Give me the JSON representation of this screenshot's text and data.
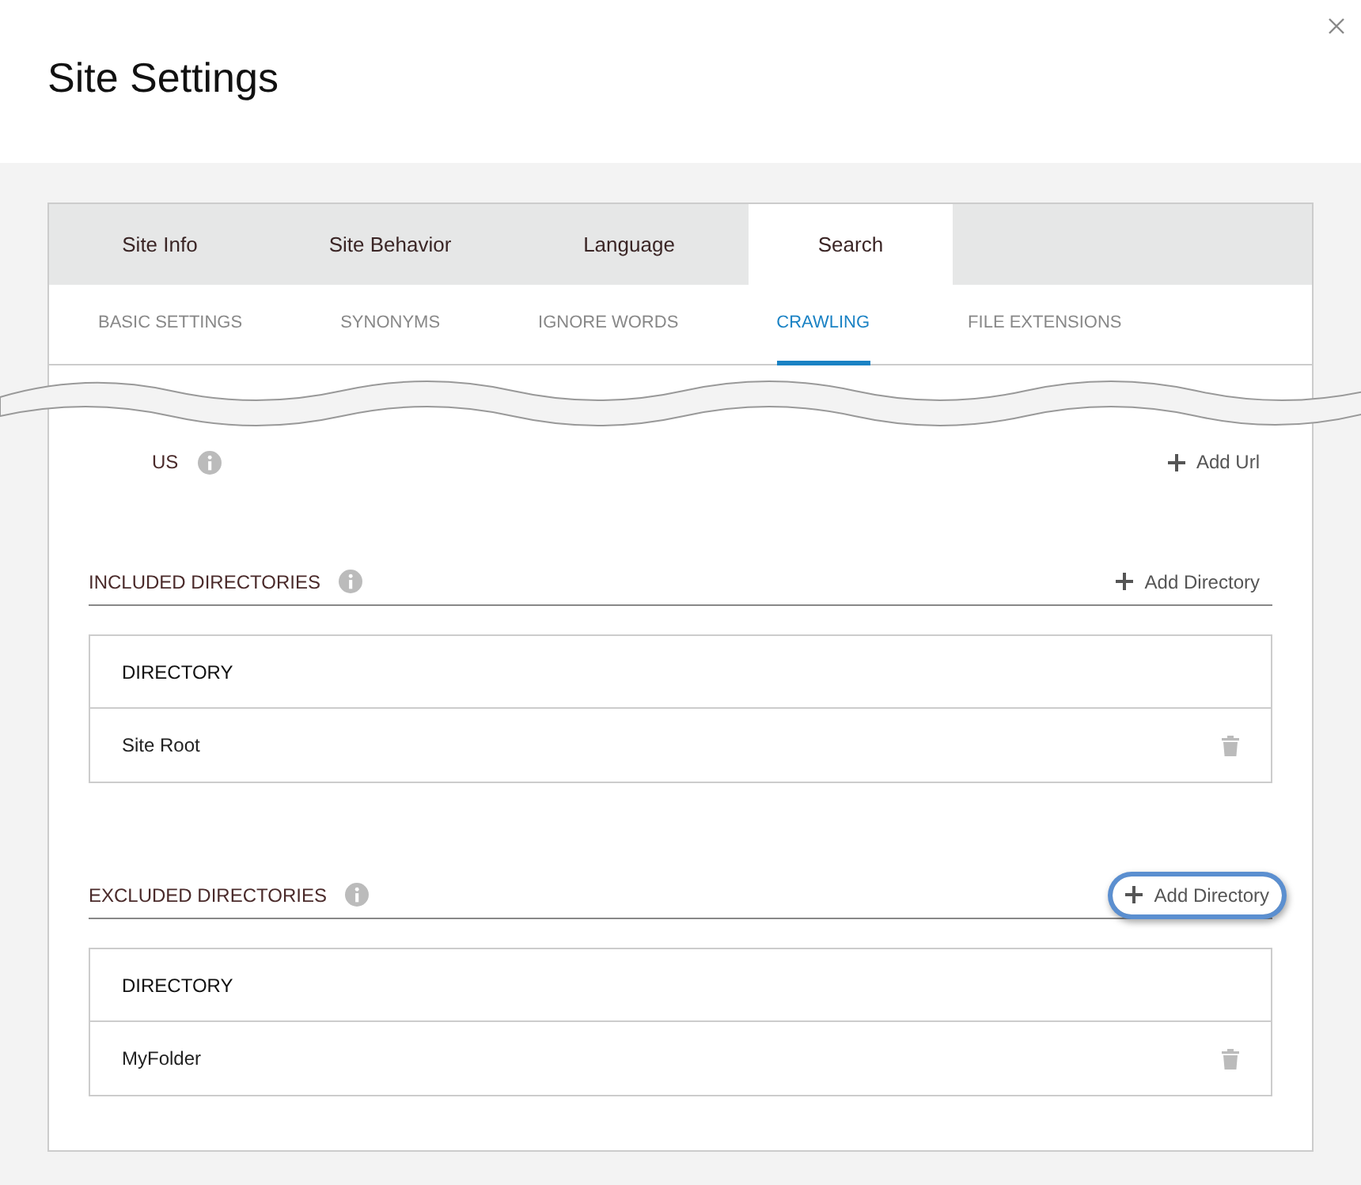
{
  "dialog": {
    "title": "Site Settings"
  },
  "tabs": [
    {
      "label": "Site Info",
      "selected": false
    },
    {
      "label": "Site Behavior",
      "selected": false
    },
    {
      "label": "Language",
      "selected": false
    },
    {
      "label": "Search",
      "selected": true
    }
  ],
  "sub_tabs": [
    {
      "label": "BASIC SETTINGS",
      "selected": false
    },
    {
      "label": "SYNONYMS",
      "selected": false
    },
    {
      "label": "IGNORE WORDS",
      "selected": false
    },
    {
      "label": "CRAWLING",
      "selected": true
    },
    {
      "label": "FILE EXTENSIONS",
      "selected": false
    }
  ],
  "torn_section": {
    "title": "US",
    "action": "Add Url"
  },
  "sections": [
    {
      "title": "INCLUDED DIRECTORIES",
      "action": "Add Directory",
      "highlighted": false,
      "column": "DIRECTORY",
      "rows": [
        "Site Root"
      ]
    },
    {
      "title": "EXCLUDED DIRECTORIES",
      "action": "Add Directory",
      "highlighted": true,
      "column": "DIRECTORY",
      "rows": [
        "MyFolder"
      ]
    }
  ]
}
